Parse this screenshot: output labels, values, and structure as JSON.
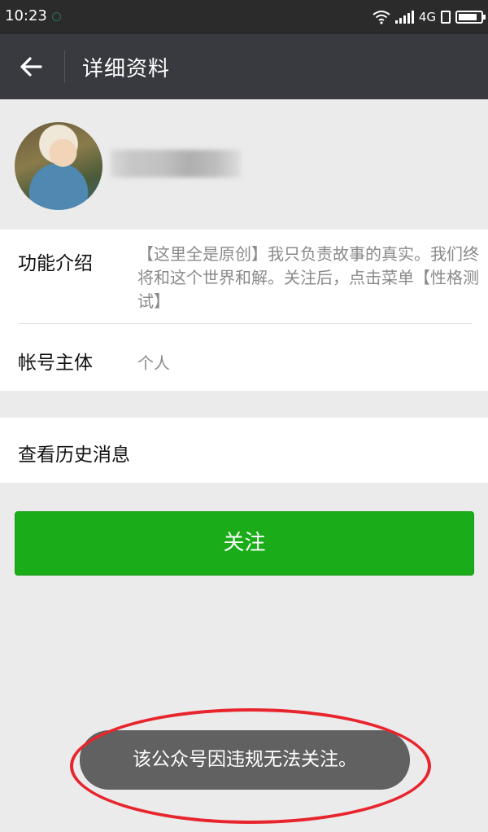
{
  "status_bar": {
    "time": "10:23",
    "network": "4G",
    "icons": [
      "wifi-icon",
      "signal-icon",
      "sim-icon",
      "battery-icon"
    ]
  },
  "header": {
    "back_icon": "arrow-left-icon",
    "title": "详细资料"
  },
  "profile": {
    "name_obscured": true
  },
  "info": {
    "intro_label": "功能介绍",
    "intro_text": "【这里全是原创】我只负责故事的真实。我们终将和这个世界和解。关注后，点击菜单【性格测试】",
    "owner_label": "帐号主体",
    "owner_value": "个人"
  },
  "history": {
    "label": "查看历史消息"
  },
  "follow": {
    "label": "关注",
    "color": "#1aad19"
  },
  "toast": {
    "message": "该公众号因违规无法关注。",
    "highlight_color": "#e8242d"
  }
}
